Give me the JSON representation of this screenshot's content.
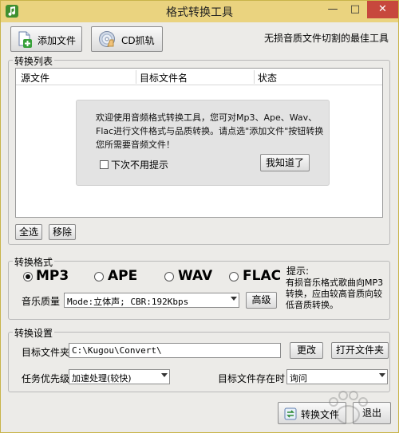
{
  "window": {
    "title": "格式转换工具",
    "controls": {
      "minimize": "—",
      "maximize": "□",
      "close": "✕"
    }
  },
  "toolbar": {
    "add_file_label": "添加文件",
    "cd_rip_label": "CD抓轨",
    "slogan": "无损音质文件切割的最佳工具"
  },
  "convert_list": {
    "group_label": "转换列表",
    "columns": [
      "源文件",
      "目标文件名",
      "状态"
    ],
    "welcome": {
      "message": "欢迎使用音频格式转换工具，您可对Mp3、Ape、Wav、Flac进行文件格式与品质转换。请点选\"添加文件\"按钮转换您所需要音频文件！",
      "no_remind_label": "下次不用提示",
      "ok_label": "我知道了"
    },
    "select_all_label": "全选",
    "remove_label": "移除"
  },
  "format": {
    "group_label": "转换格式",
    "options": [
      "MP3",
      "APE",
      "WAV",
      "FLAC"
    ],
    "selected": "MP3",
    "quality_label": "音乐质量",
    "quality_value": "Mode:立体声; CBR:192Kbps",
    "advanced_label": "高级",
    "hint_title": "提示:",
    "hint_text": "有损音乐格式歌曲向MP3转换，应由较高音质向较低音质转换。"
  },
  "settings": {
    "group_label": "转换设置",
    "target_folder_label": "目标文件夹",
    "target_folder_value": "C:\\Kugou\\Convert\\",
    "change_label": "更改",
    "open_folder_label": "打开文件夹",
    "priority_label": "任务优先级",
    "priority_value": "加速处理(较快)",
    "exists_label": "目标文件存在时",
    "exists_value": "询问"
  },
  "footer": {
    "convert_label": "转换文件",
    "exit_label": "退出"
  },
  "colors": {
    "titlebar": "#ead37f",
    "close_button": "#c7483d",
    "window_bg": "#ecebe8"
  }
}
